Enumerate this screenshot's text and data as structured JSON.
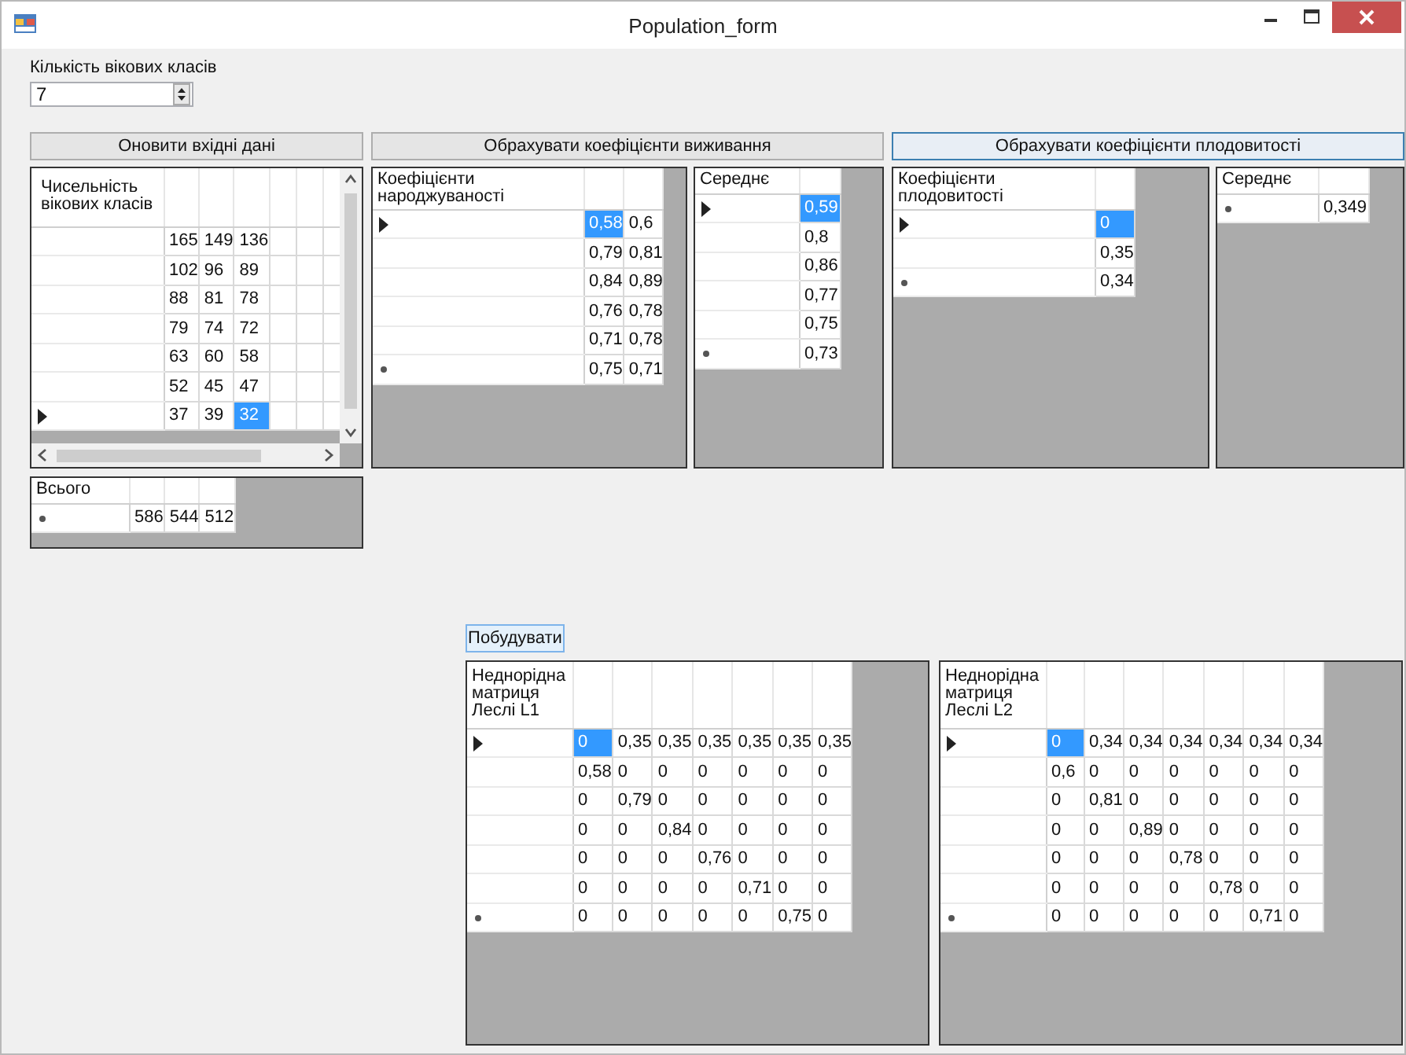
{
  "window": {
    "title": "Population_form"
  },
  "age_classes": {
    "label": "Кількість вікових класів",
    "value": "7"
  },
  "action_buttons": [
    {
      "label": "Оновити вхідні дані",
      "focused": false
    },
    {
      "label": "Обрахувати коефіцієнти виживання",
      "focused": false
    },
    {
      "label": "Обрахувати коефіцієнти плодовитості",
      "focused": true
    }
  ],
  "population_grid": {
    "header": "Чисельність вікових класів",
    "scrollable": true,
    "rows": [
      {
        "current": false,
        "new": false,
        "cells": [
          {
            "text": "165",
            "selected": false
          },
          {
            "text": "149",
            "selected": false
          },
          {
            "text": "136",
            "selected": false
          },
          {
            "selected": false
          },
          {
            "selected": false
          },
          {
            "selected": false
          }
        ]
      },
      {
        "current": false,
        "new": false,
        "cells": [
          {
            "text": "102",
            "selected": false
          },
          {
            "text": "96",
            "selected": false
          },
          {
            "text": "89",
            "selected": false
          },
          {
            "selected": false
          },
          {
            "selected": false
          },
          {
            "selected": false
          }
        ]
      },
      {
        "current": false,
        "new": false,
        "cells": [
          {
            "text": "88",
            "selected": false
          },
          {
            "text": "81",
            "selected": false
          },
          {
            "text": "78",
            "selected": false
          },
          {
            "selected": false
          },
          {
            "selected": false
          },
          {
            "selected": false
          }
        ]
      },
      {
        "current": false,
        "new": false,
        "cells": [
          {
            "text": "79",
            "selected": false
          },
          {
            "text": "74",
            "selected": false
          },
          {
            "text": "72",
            "selected": false
          },
          {
            "selected": false
          },
          {
            "selected": false
          },
          {
            "selected": false
          }
        ]
      },
      {
        "current": false,
        "new": false,
        "cells": [
          {
            "text": "63",
            "selected": false
          },
          {
            "text": "60",
            "selected": false
          },
          {
            "text": "58",
            "selected": false
          },
          {
            "selected": false
          },
          {
            "selected": false
          },
          {
            "selected": false
          }
        ]
      },
      {
        "current": false,
        "new": false,
        "cells": [
          {
            "text": "52",
            "selected": false
          },
          {
            "text": "45",
            "selected": false
          },
          {
            "text": "47",
            "selected": false
          },
          {
            "selected": false
          },
          {
            "selected": false
          },
          {
            "selected": false
          }
        ]
      },
      {
        "current": true,
        "new": false,
        "cells": [
          {
            "text": "37",
            "selected": false
          },
          {
            "text": "39",
            "selected": false
          },
          {
            "text": "32",
            "selected": true
          },
          {
            "selected": false
          },
          {
            "selected": false
          },
          {
            "selected": false
          }
        ]
      }
    ]
  },
  "birth_rate_grid": {
    "header": "Коефіцієнти народжуваності",
    "rows": [
      {
        "current": true,
        "new": false,
        "cells": [
          {
            "text": "0,58",
            "selected": true
          },
          {
            "text": "0,6",
            "selected": false
          }
        ]
      },
      {
        "current": false,
        "new": false,
        "cells": [
          {
            "text": "0,79",
            "selected": false
          },
          {
            "text": "0,81",
            "selected": false
          }
        ]
      },
      {
        "current": false,
        "new": false,
        "cells": [
          {
            "text": "0,84",
            "selected": false
          },
          {
            "text": "0,89",
            "selected": false
          }
        ]
      },
      {
        "current": false,
        "new": false,
        "cells": [
          {
            "text": "0,76",
            "selected": false
          },
          {
            "text": "0,78",
            "selected": false
          }
        ]
      },
      {
        "current": false,
        "new": false,
        "cells": [
          {
            "text": "0,71",
            "selected": false
          },
          {
            "text": "0,78",
            "selected": false
          }
        ]
      },
      {
        "current": false,
        "new": true,
        "cells": [
          {
            "text": "0,75",
            "selected": false
          },
          {
            "text": "0,71",
            "selected": false
          }
        ]
      }
    ]
  },
  "birth_mean_grid": {
    "header": "Середнє",
    "rows": [
      {
        "current": true,
        "new": false,
        "cells": [
          {
            "text": "0,59",
            "selected": true
          }
        ]
      },
      {
        "current": false,
        "new": false,
        "cells": [
          {
            "text": "0,8",
            "selected": false
          }
        ]
      },
      {
        "current": false,
        "new": false,
        "cells": [
          {
            "text": "0,86",
            "selected": false
          }
        ]
      },
      {
        "current": false,
        "new": false,
        "cells": [
          {
            "text": "0,77",
            "selected": false
          }
        ]
      },
      {
        "current": false,
        "new": false,
        "cells": [
          {
            "text": "0,75",
            "selected": false
          }
        ]
      },
      {
        "current": false,
        "new": true,
        "cells": [
          {
            "text": "0,73",
            "selected": false
          }
        ]
      }
    ]
  },
  "fertility_grid": {
    "header": "Коефіцієнти плодовитості",
    "rows": [
      {
        "current": true,
        "new": false,
        "cells": [
          {
            "text": "0",
            "selected": true
          }
        ]
      },
      {
        "current": false,
        "new": false,
        "cells": [
          {
            "text": "0,35",
            "selected": false
          }
        ]
      },
      {
        "current": false,
        "new": true,
        "cells": [
          {
            "text": "0,34",
            "selected": false
          }
        ]
      }
    ]
  },
  "fertility_mean_grid": {
    "header": "Середнє",
    "rows": [
      {
        "current": false,
        "new": true,
        "cells": [
          {
            "text": "0,349",
            "selected": false
          }
        ]
      }
    ]
  },
  "total_grid": {
    "header": "Всього",
    "rows": [
      {
        "current": false,
        "new": true,
        "cells": [
          {
            "text": "586",
            "selected": false
          },
          {
            "text": "544",
            "selected": false
          },
          {
            "text": "512",
            "selected": false
          }
        ]
      }
    ]
  },
  "build_button": {
    "label": "Побудувати"
  },
  "leslie_l1_grid": {
    "header": "Неднорідна матриця Леслі L1",
    "rows": [
      {
        "current": true,
        "new": false,
        "cells": [
          {
            "text": "0",
            "selected": true
          },
          {
            "text": "0,35",
            "selected": false
          },
          {
            "text": "0,35",
            "selected": false
          },
          {
            "text": "0,35",
            "selected": false
          },
          {
            "text": "0,35",
            "selected": false
          },
          {
            "text": "0,35",
            "selected": false
          },
          {
            "text": "0,35",
            "selected": false
          }
        ]
      },
      {
        "current": false,
        "new": false,
        "cells": [
          {
            "text": "0,58",
            "selected": false
          },
          {
            "text": "0",
            "selected": false
          },
          {
            "text": "0",
            "selected": false
          },
          {
            "text": "0",
            "selected": false
          },
          {
            "text": "0",
            "selected": false
          },
          {
            "text": "0",
            "selected": false
          },
          {
            "text": "0",
            "selected": false
          }
        ]
      },
      {
        "current": false,
        "new": false,
        "cells": [
          {
            "text": "0",
            "selected": false
          },
          {
            "text": "0,79",
            "selected": false
          },
          {
            "text": "0",
            "selected": false
          },
          {
            "text": "0",
            "selected": false
          },
          {
            "text": "0",
            "selected": false
          },
          {
            "text": "0",
            "selected": false
          },
          {
            "text": "0",
            "selected": false
          }
        ]
      },
      {
        "current": false,
        "new": false,
        "cells": [
          {
            "text": "0",
            "selected": false
          },
          {
            "text": "0",
            "selected": false
          },
          {
            "text": "0,84",
            "selected": false
          },
          {
            "text": "0",
            "selected": false
          },
          {
            "text": "0",
            "selected": false
          },
          {
            "text": "0",
            "selected": false
          },
          {
            "text": "0",
            "selected": false
          }
        ]
      },
      {
        "current": false,
        "new": false,
        "cells": [
          {
            "text": "0",
            "selected": false
          },
          {
            "text": "0",
            "selected": false
          },
          {
            "text": "0",
            "selected": false
          },
          {
            "text": "0,76",
            "selected": false
          },
          {
            "text": "0",
            "selected": false
          },
          {
            "text": "0",
            "selected": false
          },
          {
            "text": "0",
            "selected": false
          }
        ]
      },
      {
        "current": false,
        "new": false,
        "cells": [
          {
            "text": "0",
            "selected": false
          },
          {
            "text": "0",
            "selected": false
          },
          {
            "text": "0",
            "selected": false
          },
          {
            "text": "0",
            "selected": false
          },
          {
            "text": "0,71",
            "selected": false
          },
          {
            "text": "0",
            "selected": false
          },
          {
            "text": "0",
            "selected": false
          }
        ]
      },
      {
        "current": false,
        "new": true,
        "cells": [
          {
            "text": "0",
            "selected": false
          },
          {
            "text": "0",
            "selected": false
          },
          {
            "text": "0",
            "selected": false
          },
          {
            "text": "0",
            "selected": false
          },
          {
            "text": "0",
            "selected": false
          },
          {
            "text": "0,75",
            "selected": false
          },
          {
            "text": "0",
            "selected": false
          }
        ]
      }
    ]
  },
  "leslie_l2_grid": {
    "header": "Неднорідна матриця Леслі L2",
    "rows": [
      {
        "current": true,
        "new": false,
        "cells": [
          {
            "text": "0",
            "selected": true
          },
          {
            "text": "0,34",
            "selected": false
          },
          {
            "text": "0,34",
            "selected": false
          },
          {
            "text": "0,34",
            "selected": false
          },
          {
            "text": "0,34",
            "selected": false
          },
          {
            "text": "0,34",
            "selected": false
          },
          {
            "text": "0,34",
            "selected": false
          }
        ]
      },
      {
        "current": false,
        "new": false,
        "cells": [
          {
            "text": "0,6",
            "selected": false
          },
          {
            "text": "0",
            "selected": false
          },
          {
            "text": "0",
            "selected": false
          },
          {
            "text": "0",
            "selected": false
          },
          {
            "text": "0",
            "selected": false
          },
          {
            "text": "0",
            "selected": false
          },
          {
            "text": "0",
            "selected": false
          }
        ]
      },
      {
        "current": false,
        "new": false,
        "cells": [
          {
            "text": "0",
            "selected": false
          },
          {
            "text": "0,81",
            "selected": false
          },
          {
            "text": "0",
            "selected": false
          },
          {
            "text": "0",
            "selected": false
          },
          {
            "text": "0",
            "selected": false
          },
          {
            "text": "0",
            "selected": false
          },
          {
            "text": "0",
            "selected": false
          }
        ]
      },
      {
        "current": false,
        "new": false,
        "cells": [
          {
            "text": "0",
            "selected": false
          },
          {
            "text": "0",
            "selected": false
          },
          {
            "text": "0,89",
            "selected": false
          },
          {
            "text": "0",
            "selected": false
          },
          {
            "text": "0",
            "selected": false
          },
          {
            "text": "0",
            "selected": false
          },
          {
            "text": "0",
            "selected": false
          }
        ]
      },
      {
        "current": false,
        "new": false,
        "cells": [
          {
            "text": "0",
            "selected": false
          },
          {
            "text": "0",
            "selected": false
          },
          {
            "text": "0",
            "selected": false
          },
          {
            "text": "0,78",
            "selected": false
          },
          {
            "text": "0",
            "selected": false
          },
          {
            "text": "0",
            "selected": false
          },
          {
            "text": "0",
            "selected": false
          }
        ]
      },
      {
        "current": false,
        "new": false,
        "cells": [
          {
            "text": "0",
            "selected": false
          },
          {
            "text": "0",
            "selected": false
          },
          {
            "text": "0",
            "selected": false
          },
          {
            "text": "0",
            "selected": false
          },
          {
            "text": "0,78",
            "selected": false
          },
          {
            "text": "0",
            "selected": false
          },
          {
            "text": "0",
            "selected": false
          }
        ]
      },
      {
        "current": false,
        "new": true,
        "cells": [
          {
            "text": "0",
            "selected": false
          },
          {
            "text": "0",
            "selected": false
          },
          {
            "text": "0",
            "selected": false
          },
          {
            "text": "0",
            "selected": false
          },
          {
            "text": "0",
            "selected": false
          },
          {
            "text": "0,71",
            "selected": false
          },
          {
            "text": "0",
            "selected": false
          }
        ]
      }
    ]
  }
}
